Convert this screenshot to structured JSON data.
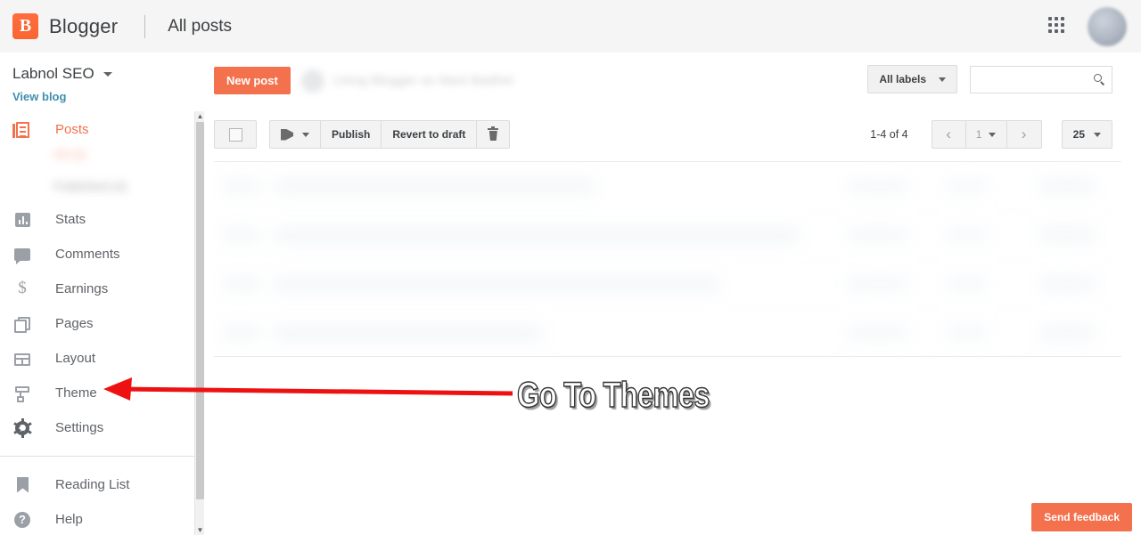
{
  "header": {
    "brand_initial": "B",
    "brand_name": "Blogger",
    "page_title": "All posts",
    "apps_icon": "apps-grid-icon",
    "avatar_icon": "user-avatar"
  },
  "sidebar": {
    "blog_name": "Labnol SEO",
    "view_blog_label": "View blog",
    "items": [
      {
        "label": "Posts",
        "icon": "posts-icon",
        "active": true
      },
      {
        "label": "Stats",
        "icon": "stats-icon",
        "active": false
      },
      {
        "label": "Comments",
        "icon": "comments-icon",
        "active": false
      },
      {
        "label": "Earnings",
        "icon": "earnings-icon",
        "active": false
      },
      {
        "label": "Pages",
        "icon": "pages-icon",
        "active": false
      },
      {
        "label": "Layout",
        "icon": "layout-icon",
        "active": false
      },
      {
        "label": "Theme",
        "icon": "theme-icon",
        "active": false
      },
      {
        "label": "Settings",
        "icon": "settings-icon",
        "active": false
      }
    ],
    "posts_submenu": [
      {
        "label": "All (4)"
      },
      {
        "label": "Published (4)"
      }
    ],
    "footer_items": [
      {
        "label": "Reading List",
        "icon": "bookmark-icon"
      },
      {
        "label": "Help",
        "icon": "help-icon"
      }
    ]
  },
  "toolbar": {
    "new_post_label": "New post",
    "ghost_post_title": "Using Blogger as Mani Badhel",
    "all_labels_label": "All labels",
    "search_placeholder": "",
    "search_value": "",
    "search_icon": "search-icon",
    "select_all_checkbox": "select-all",
    "label_icon": "label-tag-icon",
    "publish_label": "Publish",
    "revert_label": "Revert to draft",
    "delete_icon": "trash-icon",
    "count_text": "1-4 of 4",
    "prev_label": "‹",
    "page_number": "1",
    "next_label": "›",
    "per_page": "25"
  },
  "table": {
    "rows": [
      {
        "title_width": 360
      },
      {
        "title_width": 590
      },
      {
        "title_width": 500
      },
      {
        "title_width": 300
      }
    ]
  },
  "annotation": {
    "text": "Go To Themes",
    "arrow_color": "#ee1111",
    "arrow_target": "theme-icon"
  },
  "footer": {
    "send_feedback_label": "Send feedback"
  },
  "colors": {
    "brand_orange": "#f4714d",
    "header_bg": "#f5f5f5",
    "text_primary": "#3c4043",
    "text_secondary": "#5f6368",
    "link_blue": "#3e8fb0"
  }
}
